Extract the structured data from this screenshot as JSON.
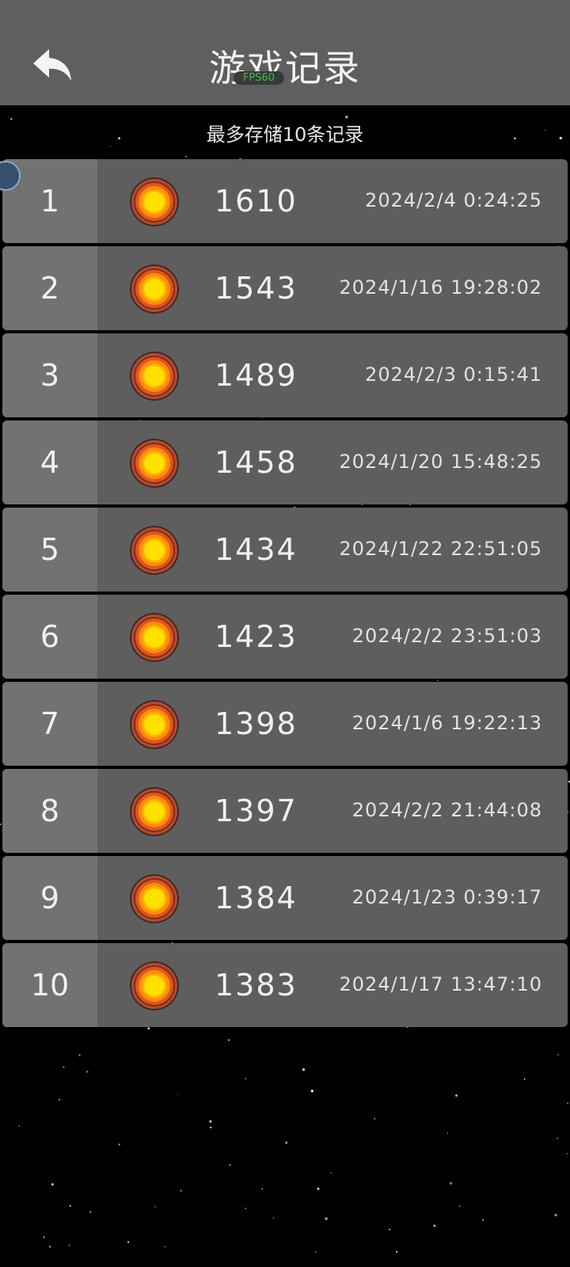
{
  "header": {
    "title": "游戏记录",
    "fps": "FPS60"
  },
  "subtitle": "最多存储10条记录",
  "colors": {
    "header_bg": "#5f5f5f",
    "row_bg": "#5e5e5e",
    "rank_bg": "#727272",
    "sun_core": "#ffe000",
    "sun_ring": "#e0561c"
  },
  "records": [
    {
      "rank": "1",
      "score": "1610",
      "time": "2024/2/4 0:24:25",
      "icon": "sun-icon"
    },
    {
      "rank": "2",
      "score": "1543",
      "time": "2024/1/16 19:28:02",
      "icon": "sun-icon"
    },
    {
      "rank": "3",
      "score": "1489",
      "time": "2024/2/3 0:15:41",
      "icon": "sun-icon"
    },
    {
      "rank": "4",
      "score": "1458",
      "time": "2024/1/20 15:48:25",
      "icon": "sun-icon"
    },
    {
      "rank": "5",
      "score": "1434",
      "time": "2024/1/22 22:51:05",
      "icon": "sun-icon"
    },
    {
      "rank": "6",
      "score": "1423",
      "time": "2024/2/2 23:51:03",
      "icon": "sun-icon"
    },
    {
      "rank": "7",
      "score": "1398",
      "time": "2024/1/6 19:22:13",
      "icon": "sun-icon"
    },
    {
      "rank": "8",
      "score": "1397",
      "time": "2024/2/2 21:44:08",
      "icon": "sun-icon"
    },
    {
      "rank": "9",
      "score": "1384",
      "time": "2024/1/23 0:39:17",
      "icon": "sun-icon"
    },
    {
      "rank": "10",
      "score": "1383",
      "time": "2024/1/17 13:47:10",
      "icon": "sun-icon"
    }
  ]
}
